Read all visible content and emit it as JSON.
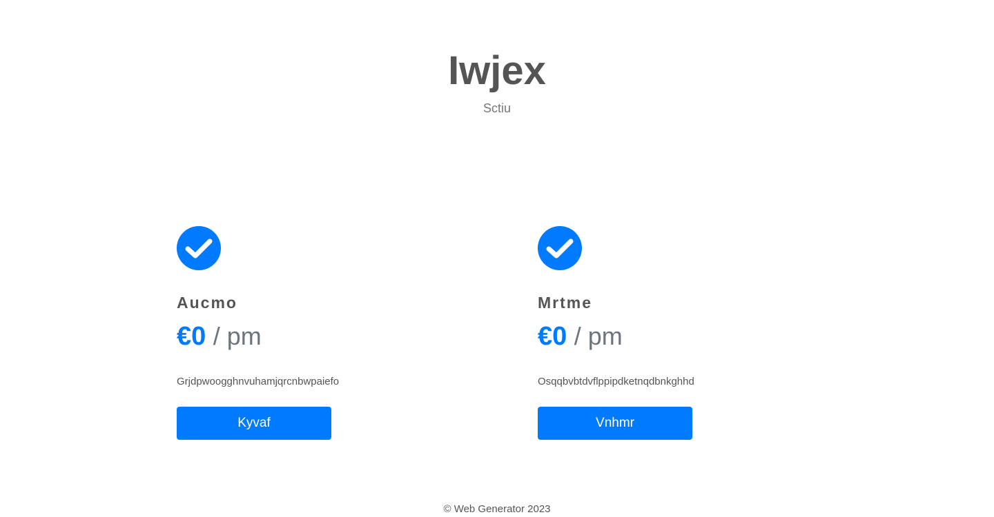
{
  "header": {
    "title": "Iwjex",
    "subtitle": "Sctiu"
  },
  "plans": [
    {
      "icon": "check-circle-icon",
      "name": "Aucmo",
      "price": "€0",
      "period": "/ pm",
      "description": "Grjdpwoogghnvuhamjqrcnbwpaiefo",
      "button_label": "Kyvaf"
    },
    {
      "icon": "check-circle-icon",
      "name": "Mrtme",
      "price": "€0",
      "period": "/ pm",
      "description": "Osqqbvbtdvflppipdketnqdbnkghhd",
      "button_label": "Vnhmr"
    }
  ],
  "footer": {
    "copyright": "© Web Generator 2023"
  },
  "colors": {
    "accent": "#007bff",
    "text": "#555555",
    "muted": "#6c757d"
  }
}
